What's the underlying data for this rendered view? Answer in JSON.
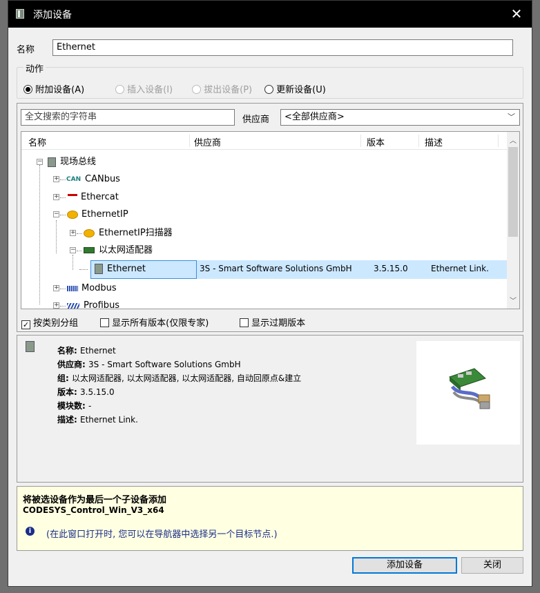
{
  "window": {
    "title": "添加设备",
    "close_glyph": "✕"
  },
  "name_field": {
    "label": "名称",
    "value": "Ethernet"
  },
  "action_group": {
    "title": "动作",
    "options": [
      {
        "label": "附加设备(A)",
        "checked": true,
        "enabled": true
      },
      {
        "label": "插入设备(I)",
        "checked": false,
        "enabled": false
      },
      {
        "label": "拔出设备(P)",
        "checked": false,
        "enabled": false
      },
      {
        "label": "更新设备(U)",
        "checked": false,
        "enabled": true
      }
    ]
  },
  "search": {
    "placeholder": "全文搜索的字符串",
    "vendor_label": "供应商",
    "vendor_value": "<全部供应商>"
  },
  "columns": {
    "name": "名称",
    "vendor": "供应商",
    "version": "版本",
    "desc": "描述"
  },
  "tree": {
    "root": "现场总线",
    "canbus": "CANbus",
    "canbus_badge": "CAN",
    "ethercat": "Ethercat",
    "ethernetip": "EthernetIP",
    "ethernetip_scanner": "EthernetIP扫描器",
    "eth_adapter": "以太网适配器",
    "selected": {
      "name": "Ethernet",
      "vendor": "3S - Smart Software Solutions GmbH",
      "version": "3.5.15.0",
      "desc": "Ethernet Link."
    },
    "modbus": "Modbus",
    "profibus": "Profibus"
  },
  "options": {
    "group_by_category": "按类别分组",
    "show_all_versions": "显示所有版本(仅限专家)",
    "show_outdated": "显示过期版本"
  },
  "details": {
    "name_label": "名称",
    "name_value": "Ethernet",
    "vendor_label": "供应商",
    "vendor_value": "3S - Smart Software Solutions GmbH",
    "group_label": "组",
    "group_value": "以太网适配器, 以太网适配器, 以太网适配器, 自动回原点&建立",
    "version_label": "版本",
    "version_value": "3.5.15.0",
    "modules_label": "模块数",
    "modules_value": "-",
    "desc_label": "描述",
    "desc_value": "Ethernet Link."
  },
  "info": {
    "headline": "将被选设备作为最后一个子设备添加",
    "target": "CODESYS_Control_Win_V3_x64",
    "hint": "(在此窗口打开时, 您可以在导航器中选择另一个目标节点.)"
  },
  "buttons": {
    "add": "添加设备",
    "close": "关闭"
  },
  "colors": {
    "selection": "#cce8ff",
    "info_bg": "#ffffe1",
    "titlebar": "#000000"
  }
}
